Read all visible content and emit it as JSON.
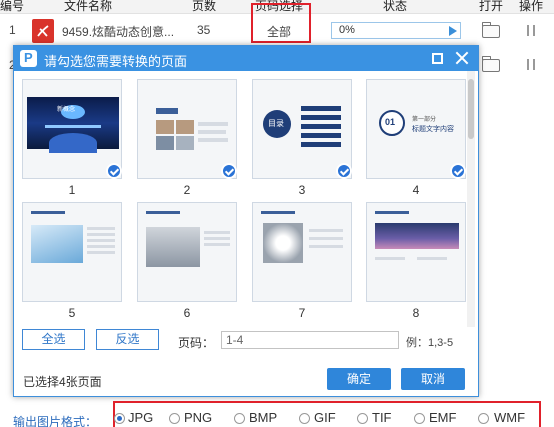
{
  "file_table": {
    "columns": [
      "编号",
      "文件名称",
      "页数",
      "页码选择",
      "状态",
      "打开",
      "操作"
    ],
    "row1": {
      "index": "1",
      "file_name": "9459.炫酷动态创意...",
      "pages": "35",
      "page_selection": "全部",
      "status_percent": "0%"
    },
    "row2": {
      "index": "2"
    }
  },
  "dialog": {
    "title": "请勾选您需要转换的页面",
    "thumbnails": [
      {
        "num": "1",
        "checked": true
      },
      {
        "num": "2",
        "checked": true
      },
      {
        "num": "3",
        "checked": true
      },
      {
        "num": "4",
        "checked": true
      },
      {
        "num": "5",
        "checked": false
      },
      {
        "num": "6",
        "checked": false
      },
      {
        "num": "7",
        "checked": false
      },
      {
        "num": "8",
        "checked": false
      }
    ],
    "slide_text": {
      "slide1": "新概念",
      "slide3": "目录",
      "slide4_number": "01",
      "slide4_line1": "第一部分",
      "slide4_line2": "标题文字内容"
    },
    "select_all": "全选",
    "invert": "反选",
    "page_code_label": "页码：",
    "page_code_value": "1-4",
    "example": "例：1,3-5",
    "selected_text": "已选择4张页面",
    "ok": "确定",
    "cancel": "取消"
  },
  "output": {
    "label": "输出图片格式：",
    "formats": [
      "JPG",
      "PNG",
      "BMP",
      "GIF",
      "TIF",
      "EMF",
      "WMF"
    ],
    "selected": "JPG"
  },
  "colors": {
    "accent": "#3a92e2",
    "highlight_box": "#e0212b",
    "check": "#2a73d6"
  }
}
